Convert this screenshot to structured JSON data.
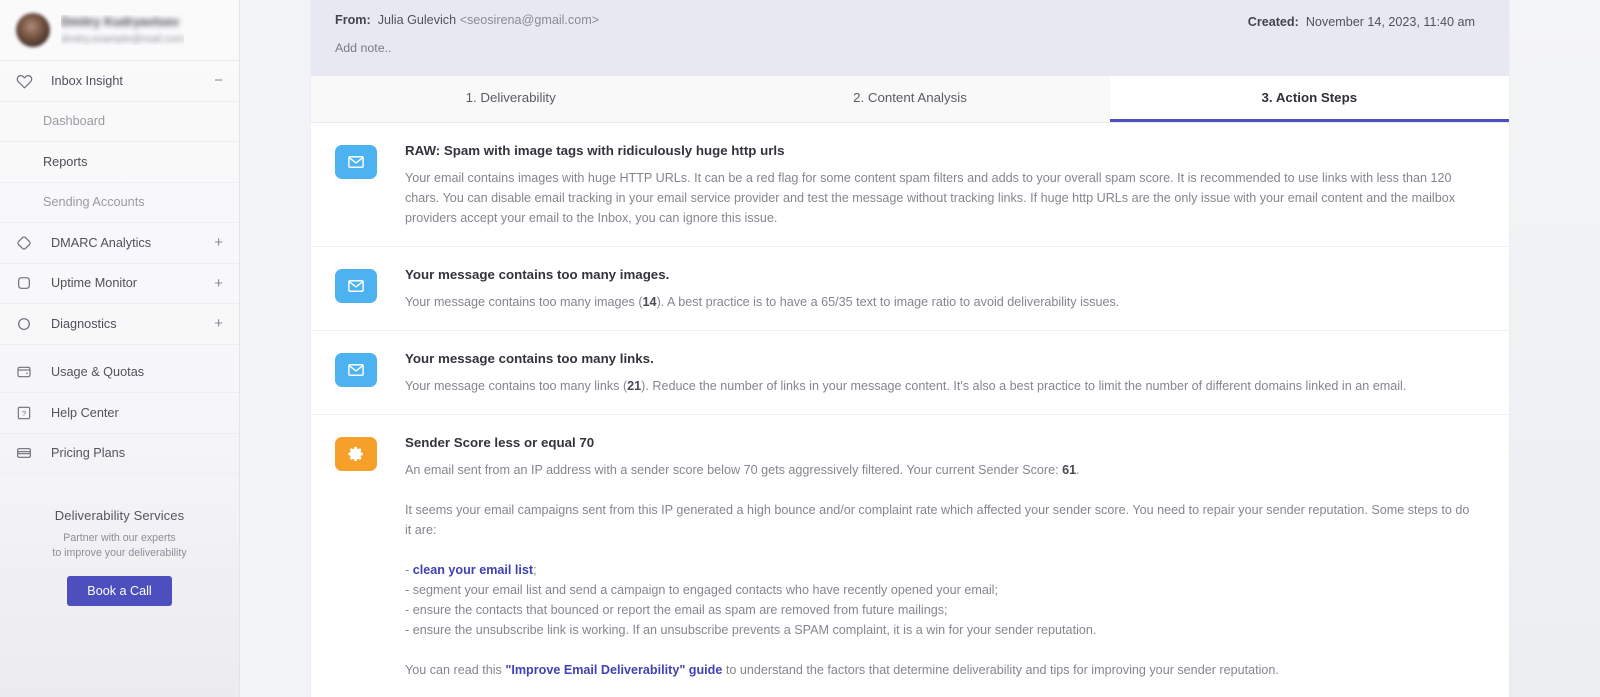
{
  "sidebar": {
    "profile": {
      "name": "Dmitry Kudryavtsev",
      "email": "dmitry.example@mail.com"
    },
    "groups": [
      {
        "icon": "heart-icon",
        "label": "Inbox Insight",
        "toggle": "−"
      },
      {
        "icon": "diamond-icon",
        "label": "DMARC Analytics",
        "toggle": "+"
      },
      {
        "icon": "square-icon",
        "label": "Uptime Monitor",
        "toggle": "+"
      },
      {
        "icon": "circle-icon",
        "label": "Diagnostics",
        "toggle": "+"
      }
    ],
    "inbox_children": [
      {
        "label": "Dashboard",
        "state": "muted"
      },
      {
        "label": "Reports",
        "state": "active"
      },
      {
        "label": "Sending Accounts",
        "state": "muted"
      }
    ],
    "utility": [
      {
        "icon": "wallet-icon",
        "label": "Usage & Quotas"
      },
      {
        "icon": "help-icon",
        "label": "Help Center"
      },
      {
        "icon": "card-icon",
        "label": "Pricing Plans"
      }
    ],
    "promo": {
      "title": "Deliverability Services",
      "line1": "Partner with our experts",
      "line2": "to improve your deliverability",
      "button": "Book a Call"
    }
  },
  "header": {
    "from_label": "From:",
    "from_name": "Julia Gulevich",
    "from_email": "<seosirena@gmail.com>",
    "add_note": "Add note..",
    "created_label": "Created:",
    "created_value": "November 14, 2023, 11:40 am"
  },
  "tabs": [
    {
      "label": "1. Deliverability",
      "active": false
    },
    {
      "label": "2. Content Analysis",
      "active": false
    },
    {
      "label": "3. Action Steps",
      "active": true
    }
  ],
  "items": [
    {
      "icon": "mail-icon",
      "icon_color": "#4db2f0",
      "title": "RAW: Spam with image tags with ridiculously huge http urls",
      "text": "Your email contains images with huge HTTP URLs. It can be a red flag for some content spam filters and adds to your overall spam score. It is recommended to use links with less than 120 chars. You can disable email tracking in your email service provider and test the message without tracking links. If huge http URLs are the only issue with your email content and the mailbox providers accept your email to the Inbox, you can ignore this issue."
    },
    {
      "icon": "mail-icon",
      "icon_color": "#4db2f0",
      "title": "Your message contains too many images.",
      "text_pre": "Your message contains too many images (",
      "text_bold": "14",
      "text_post": "). A best practice is to have a 65/35 text to image ratio to avoid deliverability issues."
    },
    {
      "icon": "mail-icon",
      "icon_color": "#4db2f0",
      "title": "Your message contains too many links.",
      "text_pre": "Your message contains too many links (",
      "text_bold": "21",
      "text_post": "). Reduce the number of links in your message content. It's also a best practice to limit the number of different domains linked in an email."
    },
    {
      "icon": "gear-icon",
      "icon_color": "#f6a02a",
      "title": "Sender Score less or equal 70",
      "text_pre": "An email sent from an IP address with a sender score below 70 gets aggressively filtered. Your current Sender Score: ",
      "text_bold": "61",
      "text_post": ".",
      "para2": "It seems your email campaigns sent from this IP generated a high bounce and/or complaint rate which affected your sender score. You need to repair your sender reputation. Some steps to do it are:",
      "bullets": [
        {
          "dash": "- ",
          "link": "clean your email list",
          "rest": ";"
        },
        {
          "dash": "- ",
          "link": "",
          "rest": "segment your email list and send a campaign to engaged contacts who have recently opened your email;"
        },
        {
          "dash": "- ",
          "link": "",
          "rest": "ensure the contacts that bounced or report the email as spam are removed from future mailings;"
        },
        {
          "dash": "- ",
          "link": "",
          "rest": "ensure the unsubscribe link is working. If an unsubscribe prevents a SPAM complaint, it is a win for your sender reputation."
        }
      ],
      "footer_pre": "You can read this ",
      "footer_link": "\"Improve Email Deliverability\" guide",
      "footer_post": " to understand the factors that determine deliverability and tips for improving your sender reputation."
    }
  ],
  "colors": {
    "accent": "#4d4fbe",
    "mail_icon": "#4db2f0",
    "gear_icon": "#f6a02a",
    "header_bg": "#e7e8f2",
    "cursor_halo": "#fbf28a"
  }
}
